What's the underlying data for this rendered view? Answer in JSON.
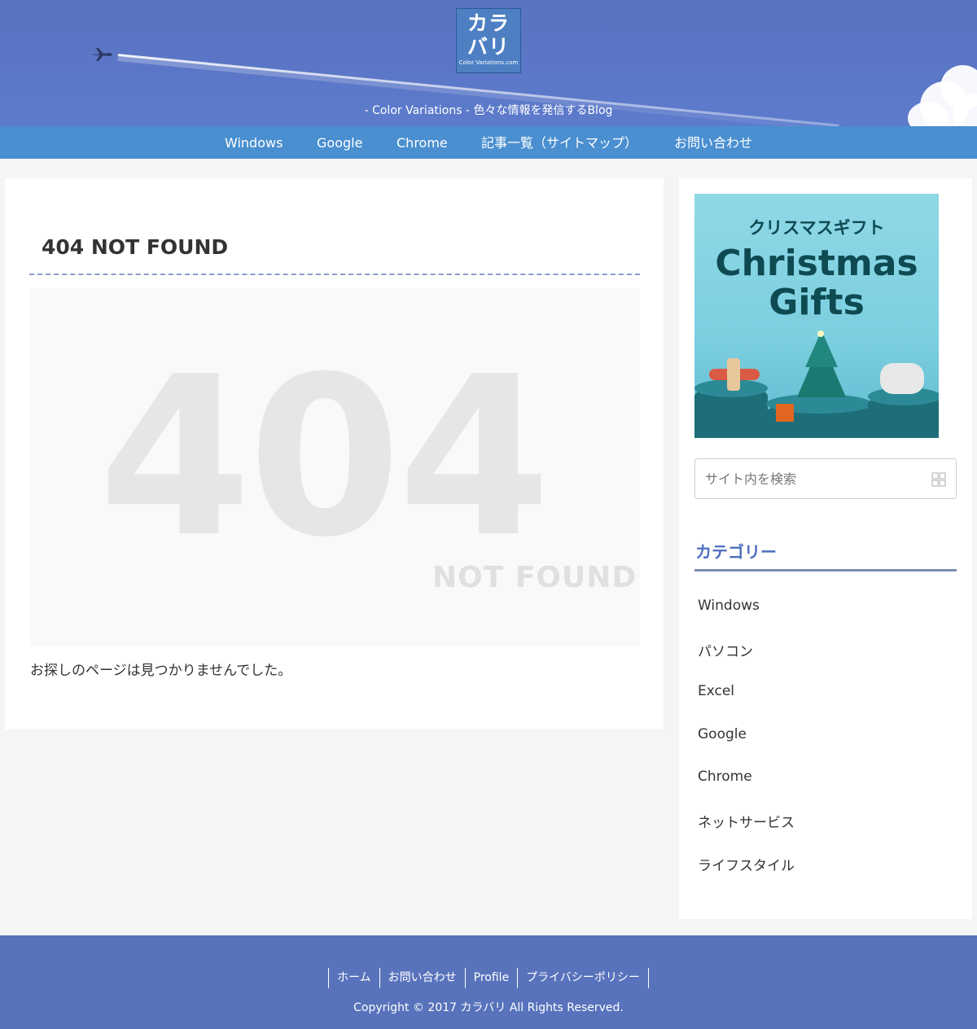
{
  "header": {
    "logo_main": "カラ\nバリ",
    "logo_main_line1": "カラ",
    "logo_main_line2": "バリ",
    "logo_sub": "Color Variations.com",
    "tagline": "- Color Variations - 色々な情報を発信するBlog"
  },
  "nav": {
    "items": [
      "Windows",
      "Google",
      "Chrome",
      "記事一覧（サイトマップ）",
      "お問い合わせ"
    ]
  },
  "main": {
    "title": "404 NOT FOUND",
    "image_big": "404",
    "image_sub": "NOT FOUND",
    "message": "お探しのページは見つかりませんでした。"
  },
  "sidebar": {
    "banner_jp": "クリスマスギフト",
    "banner_en_line1": "Christmas",
    "banner_en_line2": "Gifts",
    "search_placeholder": "サイト内を検索",
    "category_title": "カテゴリー",
    "categories": [
      "Windows",
      "パソコン",
      "Excel",
      "Google",
      "Chrome",
      "ネットサービス",
      "ライフスタイル"
    ]
  },
  "footer": {
    "links": [
      "ホーム",
      "お問い合わせ",
      "Profile",
      "プライバシーポリシー"
    ],
    "copyright": "Copyright © 2017 カラバリ All Rights Reserved."
  },
  "colors": {
    "header_bg": "#5b76c6",
    "nav_bg": "#4a8fd0",
    "footer_bg": "#5873bc",
    "accent": "#4d6fbf"
  }
}
